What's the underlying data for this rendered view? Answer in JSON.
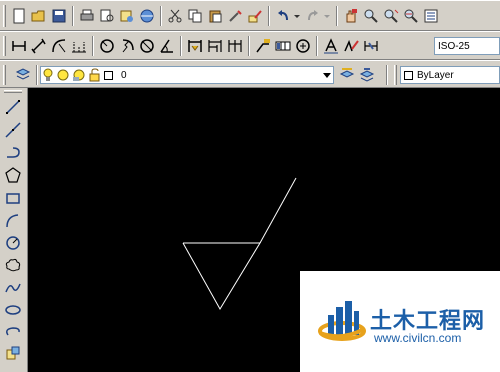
{
  "toolbar_standard": {
    "buttons": [
      "new-icon",
      "open-icon",
      "save-icon",
      "print-icon",
      "plot-preview-icon",
      "publish-icon",
      "3d-dwf-icon",
      "cut-icon",
      "copy-icon",
      "paste-icon",
      "match-properties-icon",
      "block-editor-icon",
      "undo-icon",
      "redo-icon",
      "pan-icon",
      "zoom-realtime-icon",
      "zoom-window-icon",
      "zoom-previous-icon",
      "properties-icon"
    ]
  },
  "toolbar_dimension": {
    "buttons": [
      "linear-dim-icon",
      "aligned-dim-icon",
      "arc-length-icon",
      "ordinate-dim-icon",
      "radius-dim-icon",
      "jogged-dim-icon",
      "diameter-dim-icon",
      "angular-dim-icon",
      "quick-dim-icon",
      "baseline-dim-icon",
      "continue-dim-icon",
      "quick-leader-icon",
      "tolerance-icon",
      "center-mark-icon",
      "dim-edit-icon",
      "dim-text-edit-icon",
      "dim-update-icon"
    ],
    "dim_style": "ISO-25"
  },
  "toolbar_layers": {
    "layer_name": "0",
    "color_control": "ByLayer"
  },
  "draw_toolbar": {
    "tools": [
      "line-icon",
      "construction-line-icon",
      "polyline-icon",
      "polygon-icon",
      "rectangle-icon",
      "arc-icon",
      "circle-icon",
      "revision-cloud-icon",
      "spline-icon",
      "ellipse-icon",
      "ellipse-arc-icon",
      "insert-block-icon"
    ]
  },
  "watermark": {
    "title": "土木工程网",
    "url": "www.civilcn.com",
    "brand_color": "#1c5fa8"
  }
}
